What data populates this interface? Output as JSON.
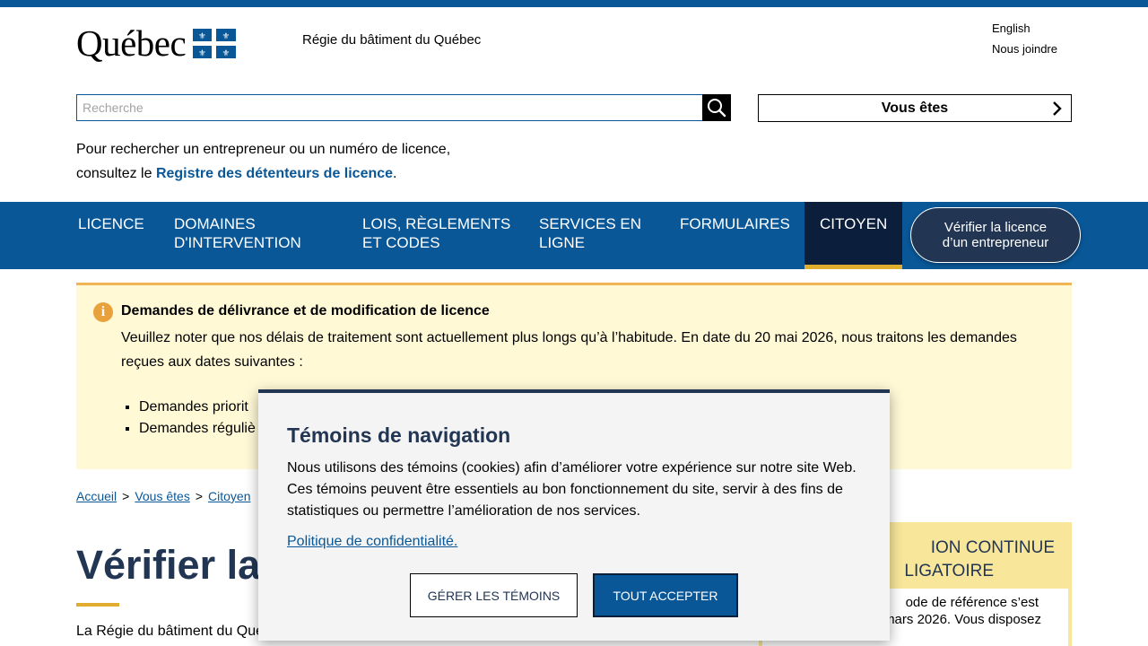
{
  "header": {
    "logo_text": "Québec",
    "org_name": "Régie du bâtiment du Québec",
    "utility_links": [
      "English",
      "Nous joindre"
    ]
  },
  "search": {
    "placeholder": "Recherche",
    "value": ""
  },
  "audience_selector": {
    "label": "Vous êtes"
  },
  "intro": {
    "line1": "Pour rechercher un entrepreneur ou un numéro de licence,",
    "line2_prefix": "consultez le ",
    "link": "Registre des détenteurs de licence",
    "line2_suffix": "."
  },
  "nav": {
    "items": [
      {
        "line1": "LICENCE",
        "line2": ""
      },
      {
        "line1": "DOMAINES",
        "line2": "D'INTERVENTION"
      },
      {
        "line1": "LOIS, RÈGLEMENTS",
        "line2": "ET CODES"
      },
      {
        "line1": "SERVICES EN",
        "line2": "LIGNE"
      },
      {
        "line1": "FORMULAIRES",
        "line2": ""
      },
      {
        "line1": "CITOYEN",
        "line2": ""
      }
    ],
    "cta_line1": "Vérifier la licence",
    "cta_line2": "d’un entrepreneur"
  },
  "alert": {
    "title": "Demandes de délivrance et de modification de licence",
    "text": "Veuillez noter que nos délais de traitement sont actuellement plus longs qu’à l’habitude. En date du 20 mai 2026, nous traitons les demandes reçues aux dates suivantes :",
    "items": [
      "Demandes priorit",
      "Demandes réguliè"
    ]
  },
  "breadcrumb": {
    "items": [
      "Accueil",
      "Vous êtes",
      "Citoyen"
    ],
    "separator": ">"
  },
  "page": {
    "title": "Vérifier la",
    "body": "La Régie du bâtiment du Québec (RBQ) délivre des licences aux entrepreneurs en construction et"
  },
  "side_box": {
    "title_line1": "ION CONTINUE",
    "title_line2": "LIGATOIRE",
    "text_line1": "ode de référence s’est",
    "text_line2": "terminée le 31 mars 2026. Vous disposez"
  },
  "cookie_modal": {
    "title": "Témoins de navigation",
    "text": "Nous utilisons des témoins (cookies) afin d’améliorer votre expérience sur notre site Web. Ces témoins peuvent être essentiels au bon fonctionnement du site, servir à des fins de statistiques ou permettre l’amélioration de nos services.",
    "policy_link": "Politique de confidentialité.",
    "manage_label": "GÉRER LES TÉMOINS",
    "accept_label": "TOUT ACCEPTER"
  },
  "colors": {
    "brand_blue": "#095797",
    "dark_blue": "#223654",
    "active_nav": "#0b1e3b",
    "accent_yellow": "#e0ad2e",
    "alert_bg": "#fff9d6"
  }
}
